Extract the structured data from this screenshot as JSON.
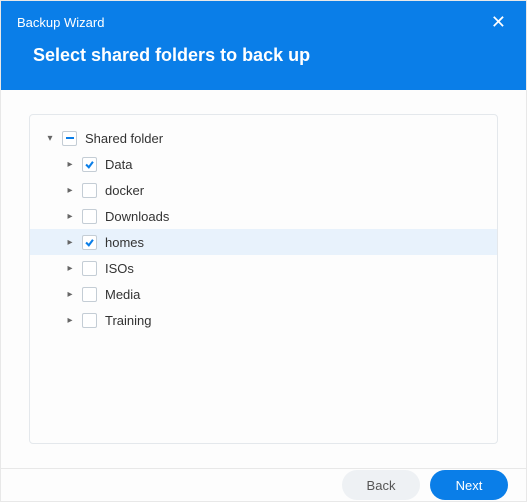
{
  "title": "Backup Wizard",
  "heading": "Select shared folders to back up",
  "tree": {
    "root": {
      "label": "Shared folder",
      "state": "indeterminate",
      "expanded": true
    },
    "items": [
      {
        "label": "Data",
        "checked": true,
        "selected": false
      },
      {
        "label": "docker",
        "checked": false,
        "selected": false
      },
      {
        "label": "Downloads",
        "checked": false,
        "selected": false
      },
      {
        "label": "homes",
        "checked": true,
        "selected": true
      },
      {
        "label": "ISOs",
        "checked": false,
        "selected": false
      },
      {
        "label": "Media",
        "checked": false,
        "selected": false
      },
      {
        "label": "Training",
        "checked": false,
        "selected": false
      }
    ]
  },
  "buttons": {
    "back": "Back",
    "next": "Next"
  }
}
